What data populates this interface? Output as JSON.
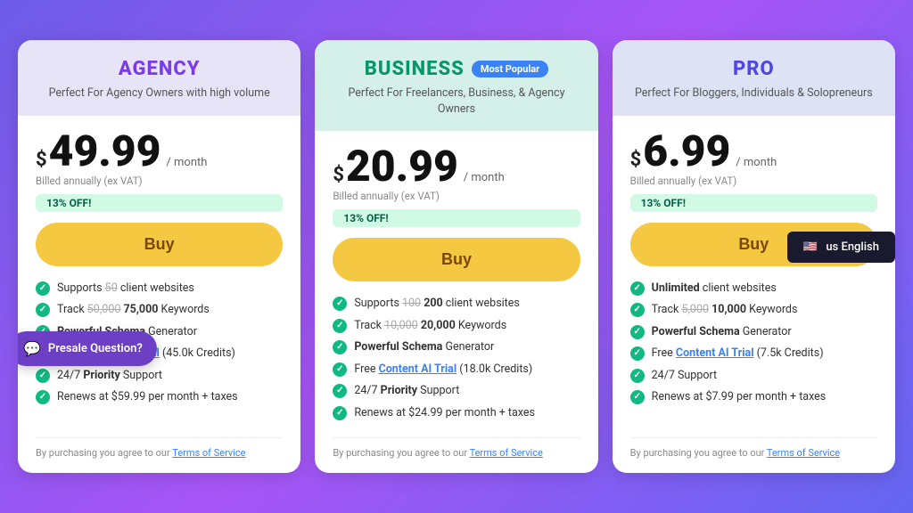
{
  "cards": [
    {
      "id": "agency",
      "title": "AGENCY",
      "subtitle": "Perfect For Agency Owners with high volume",
      "badge": null,
      "header_bg": "agency",
      "price_dollar": "$",
      "price": "49.99",
      "period": "/ month",
      "billed": "Billed annually (ex VAT)",
      "off": "13% OFF!",
      "buy_label": "Buy",
      "features": [
        {
          "text": "Supports <span class='strikethrough'>50</span> client websites",
          "bold": false
        },
        {
          "text": "Track <span class='strikethrough'>50,000</span> <b>75,000</b> Keywords",
          "bold": false
        },
        {
          "text": "<b>Powerful Schema</b> Generator",
          "bold": false
        },
        {
          "text": "Free <b class='feature-link'>Content AI Trial</b> (45.0k Credits)",
          "bold": false
        },
        {
          "text": "24/7 <b>Priority</b> Support",
          "bold": false
        },
        {
          "text": "Renews at $59.99 per month + taxes",
          "bold": false
        }
      ],
      "tos": "By purchasing you agree to our",
      "tos_link": "Terms of Service"
    },
    {
      "id": "business",
      "title": "BUSINESS",
      "subtitle": "Perfect For Freelancers, Business, & Agency Owners",
      "badge": "Most Popular",
      "header_bg": "business",
      "price_dollar": "$",
      "price": "20.99",
      "period": "/ month",
      "billed": "Billed annually (ex VAT)",
      "off": "13% OFF!",
      "buy_label": "Buy",
      "features": [
        {
          "text": "Supports <span class='strikethrough'>100</span> <b>200</b> client websites",
          "bold": false
        },
        {
          "text": "Track <span class='strikethrough'>10,000</span> <b>20,000</b> Keywords",
          "bold": false
        },
        {
          "text": "<b>Powerful Schema</b> Generator",
          "bold": false
        },
        {
          "text": "Free <b class='feature-link'>Content AI Trial</b> (18.0k Credits)",
          "bold": false
        },
        {
          "text": "24/7 <b>Priority</b> Support",
          "bold": false
        },
        {
          "text": "Renews at $24.99 per month + taxes",
          "bold": false
        }
      ],
      "tos": "By purchasing you agree to our",
      "tos_link": "Terms of Service"
    },
    {
      "id": "pro",
      "title": "PRO",
      "subtitle": "Perfect For Bloggers, Individuals & Solopreneurs",
      "badge": null,
      "header_bg": "pro",
      "price_dollar": "$",
      "price": "6.99",
      "period": "/ month",
      "billed": "Billed annually (ex VAT)",
      "off": "13% OFF!",
      "buy_label": "Buy",
      "features": [
        {
          "text": "Unlim... client websites",
          "bold": false
        },
        {
          "text": "Track ...",
          "bold": false
        },
        {
          "text": "<b>Powerful Schema</b> Generator",
          "bold": false
        },
        {
          "text": "Free <b class='feature-link'>Content AI Trial</b> (7.5k Credits)",
          "bold": false
        },
        {
          "text": "24/7 Support",
          "bold": false
        },
        {
          "text": "Renews at $7.99 per month + taxes",
          "bold": false
        }
      ],
      "tos": "By purchasing you agree to our",
      "tos_link": "Terms of Service"
    }
  ],
  "presale": {
    "label": "Presale Question?"
  },
  "lang_tooltip": {
    "flag": "🇺🇸",
    "label": "us English"
  }
}
